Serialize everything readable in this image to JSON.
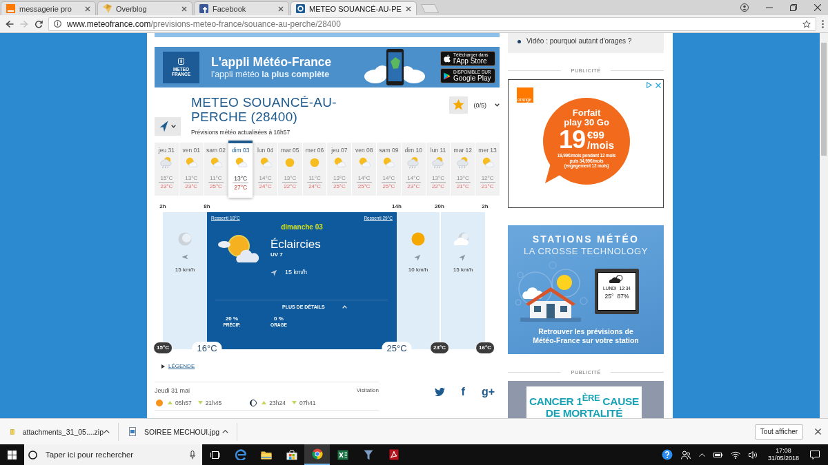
{
  "browser": {
    "tabs": [
      {
        "title": "messagerie pro",
        "kind": "mail",
        "selected": false
      },
      {
        "title": "Overblog",
        "kind": "blog",
        "selected": false
      },
      {
        "title": "Facebook",
        "kind": "social",
        "selected": false
      },
      {
        "title": "METEO SOUANCÉ-AU-PE",
        "kind": "weather",
        "selected": true
      }
    ],
    "forward": {
      "disabled": true
    },
    "address": {
      "host": "www.meteofrance.com",
      "path": "/previsions-meteo-france/souance-au-perche/28400"
    }
  },
  "page": {
    "app_banner": {
      "logo": "METEO\nFRANCE",
      "title": "L'appli Météo-France",
      "subtitle": "l'appli météo **la plus complète**",
      "stores": [
        {
          "kind": "apple",
          "small": "Télécharger dans",
          "name": "l'App Store"
        },
        {
          "kind": "play",
          "small": "DISPONIBLE SUR",
          "name": "Google Play"
        }
      ]
    },
    "location": {
      "title": "METEO SOUANCÉ-AU-PERCHE (28400)",
      "updated": "Prévisions météo actualisées à 16h57",
      "favorites": "(0/5)"
    },
    "days": [
      {
        "day": "jeu 31",
        "kind": "showers",
        "min": "15°C",
        "max": "23°C",
        "selected": false
      },
      {
        "day": "ven 01",
        "kind": "partly",
        "min": "13°C",
        "max": "23°C",
        "selected": false
      },
      {
        "day": "sam 02",
        "kind": "partly",
        "min": "11°C",
        "max": "25°C",
        "selected": false
      },
      {
        "day": "dim 03",
        "kind": "partly",
        "min": "13°C",
        "max": "27°C",
        "selected": true
      },
      {
        "day": "lun 04",
        "kind": "partly",
        "min": "14°C",
        "max": "24°C",
        "selected": false
      },
      {
        "day": "mar 05",
        "kind": "sunny",
        "min": "13°C",
        "max": "22°C",
        "selected": false
      },
      {
        "day": "mer 06",
        "kind": "sunny",
        "min": "11°C",
        "max": "24°C",
        "selected": false
      },
      {
        "day": "jeu 07",
        "kind": "partly",
        "min": "13°C",
        "max": "25°C",
        "selected": false
      },
      {
        "day": "ven 08",
        "kind": "partly",
        "min": "14°C",
        "max": "25°C",
        "selected": false
      },
      {
        "day": "sam 09",
        "kind": "partly",
        "min": "14°C",
        "max": "25°C",
        "selected": false
      },
      {
        "day": "dim 10",
        "kind": "showers",
        "min": "14°C",
        "max": "23°C",
        "selected": false
      },
      {
        "day": "lun 11",
        "kind": "showers",
        "min": "13°C",
        "max": "22°C",
        "selected": false
      },
      {
        "day": "mar 12",
        "kind": "showers",
        "min": "13°C",
        "max": "21°C",
        "selected": false
      },
      {
        "day": "mer 13",
        "kind": "partly",
        "min": "12°C",
        "max": "21°C",
        "selected": false
      }
    ],
    "timeline": {
      "hours": [
        "2h",
        "8h",
        "14h",
        "20h",
        "2h"
      ],
      "periods": [
        {
          "kind": "moon",
          "wind": {
            "kind": "west",
            "text": "15 km/h"
          }
        },
        {
          "kind": "detail",
          "feels_start": "Ressenti 18°C",
          "feels_end": "Ressenti 29°C",
          "day": "dimanche 03",
          "condition": "Éclaircies",
          "uv": "UV 7",
          "wind": {
            "kind": "north-east",
            "text": "15 km/h"
          },
          "more": "PLUS DE DÉTAILS",
          "stats": [
            {
              "value": "20 %",
              "label": "PRÉCIP."
            },
            {
              "value": "0 %",
              "label": "ORAGE"
            }
          ]
        },
        {
          "kind": "sun",
          "wind": {
            "kind": "north-east",
            "text": "10 km/h"
          }
        },
        {
          "kind": "moon-cloud",
          "wind": {
            "kind": "north-east",
            "text": "15 km/h"
          }
        }
      ],
      "temps": [
        {
          "text": "15°C",
          "selected": false
        },
        {
          "text": "16°C",
          "selected": true
        },
        {
          "text": "25°C",
          "selected": true
        },
        {
          "text": "23°C",
          "selected": false
        },
        {
          "text": "16°C",
          "selected": false
        }
      ]
    },
    "legend": "LÉGENDE",
    "ephemeris": {
      "date": "Jeudi 31 mai",
      "saint": "Visitation",
      "sunrise": "05h57",
      "sunset": "21h45",
      "moonrise": "23h24",
      "moonset": "07h41"
    },
    "share": [
      {
        "kind": "bird"
      },
      {
        "kind": "glyph",
        "text": "f"
      },
      {
        "kind": "glyph",
        "text": "g+"
      }
    ],
    "sidebar": {
      "top_link": "Vidéo : pourquoi autant d'orages ?",
      "ad_label_top": "PUBLICITÉ",
      "offer_ad": {
        "brand": "orange",
        "title": "Forfait\nplay 30 Go",
        "price": "19",
        "cents": "€99",
        "unit": "/mois",
        "terms": "19,99€/mois pendant 12 mois\npuis 34,99€/mois\n(engagement 12 mois)"
      },
      "station_ad": {
        "title": "STATIONS MÉTÉO",
        "subtitle": "LA CROSSE TECHNOLOGY",
        "screen_day": "LUNDI",
        "screen_time": "12:34",
        "screen_temp": "25°",
        "screen_humidity": "87%",
        "caption": "Retrouver les prévisions de\nMétéo-France sur votre station"
      },
      "ad_label_bottom": "PUBLICITÉ",
      "health_ad": {
        "headline": "CANCER 1$^{ÈRE}$ CAUSE\nDE MORTALITÉ"
      }
    }
  },
  "downloads": {
    "items": [
      {
        "kind": "zip",
        "name": "attachments_31_05....zip"
      },
      {
        "kind": "image",
        "name": "SOIREE MECHOUI.jpg"
      }
    ],
    "show_all": "Tout afficher"
  },
  "taskbar": {
    "search": {
      "placeholder": "Taper ici pour rechercher"
    },
    "apps": [
      {
        "kind": "task-view",
        "selected": false
      },
      {
        "kind": "e-browser",
        "selected": false
      },
      {
        "kind": "folder",
        "selected": false
      },
      {
        "kind": "store",
        "selected": false
      },
      {
        "kind": "ring-browser",
        "selected": true
      },
      {
        "kind": "sheet",
        "selected": false
      },
      {
        "kind": "funnel",
        "selected": false
      },
      {
        "kind": "pdf",
        "selected": false
      }
    ],
    "time": "17:08",
    "date": "31/05/2018"
  }
}
